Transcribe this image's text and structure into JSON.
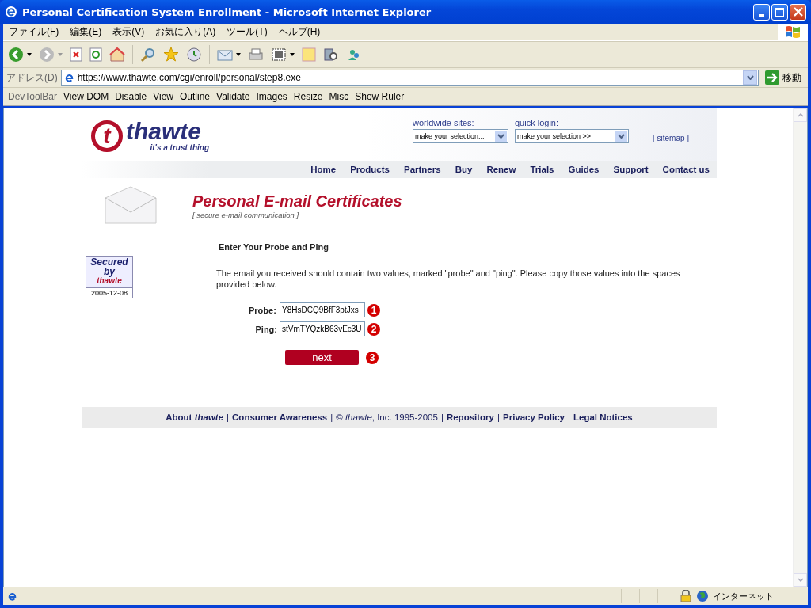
{
  "window": {
    "title": "Personal Certification System Enrollment - Microsoft Internet Explorer"
  },
  "menu": [
    "ファイル(F)",
    "編集(E)",
    "表示(V)",
    "お気に入り(A)",
    "ツール(T)",
    "ヘルプ(H)"
  ],
  "address": {
    "label": "アドレス(D)",
    "url": "https://www.thawte.com/cgi/enroll/personal/step8.exe",
    "go": "移動"
  },
  "devtoolbar": {
    "label": "DevToolBar",
    "items": [
      "View DOM",
      "Disable",
      "View",
      "Outline",
      "Validate",
      "Images",
      "Resize",
      "Misc",
      "Show Ruler"
    ]
  },
  "header": {
    "logo_mark": "t",
    "logo": "thawte",
    "tagline": "it's a trust thing",
    "worldwide_label": "worldwide sites:",
    "worldwide_value": "make your selection...",
    "login_label": "quick login:",
    "login_value": "make your selection >>",
    "sitemap": "[ sitemap ]"
  },
  "nav": [
    "Home",
    "Products",
    "Partners",
    "Buy",
    "Renew",
    "Trials",
    "Guides",
    "Support",
    "Contact us"
  ],
  "banner": {
    "title": "Personal E-mail Certificates",
    "subtitle": "[ secure e-mail communication ]"
  },
  "seal": {
    "line1": "Secured",
    "line2": "by",
    "brand": "thawte",
    "date": "2005-12-08"
  },
  "form": {
    "heading": "Enter Your Probe and Ping",
    "intro": "The email you received should contain two values, marked \"probe\" and \"ping\". Please copy those values into the spaces provided below.",
    "fields": [
      {
        "label": "Probe:",
        "value": "Y8HsDCQ9BfF3ptJxs",
        "marker": "1"
      },
      {
        "label": "Ping:",
        "value": "stVmTYQzkB63vEc3U",
        "marker": "2"
      }
    ],
    "button": "next",
    "button_marker": "3"
  },
  "footer": {
    "separator": "|",
    "links": [
      "About *thawte*",
      "Consumer Awareness",
      "© *thawte*, Inc. 1995-2005",
      "Repository",
      "Privacy Policy",
      "Legal Notices"
    ]
  },
  "status_bar": {
    "zone": "インターネット"
  }
}
